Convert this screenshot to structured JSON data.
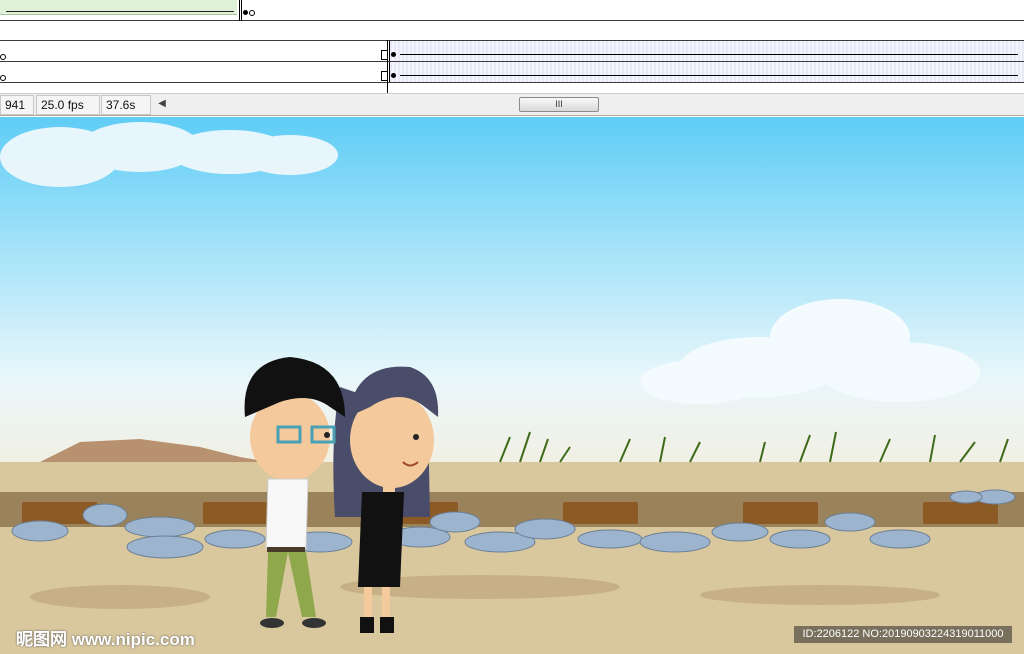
{
  "timeline": {
    "frame_number": "941",
    "fps": "25.0 fps",
    "elapsed": "37.6s",
    "scroll_thumb_glyph": "III"
  },
  "watermark": {
    "site": "昵图网 www.nipic.com",
    "id_text": "ID:2206122 NO:20190903224319011000"
  },
  "colors": {
    "sky_top": "#5fcdf6",
    "sky_bottom": "#e9f7fb",
    "ground": "#d9c89e",
    "tween": "#dff2d8"
  },
  "icons": [
    "scroll-left-arrow-icon"
  ]
}
